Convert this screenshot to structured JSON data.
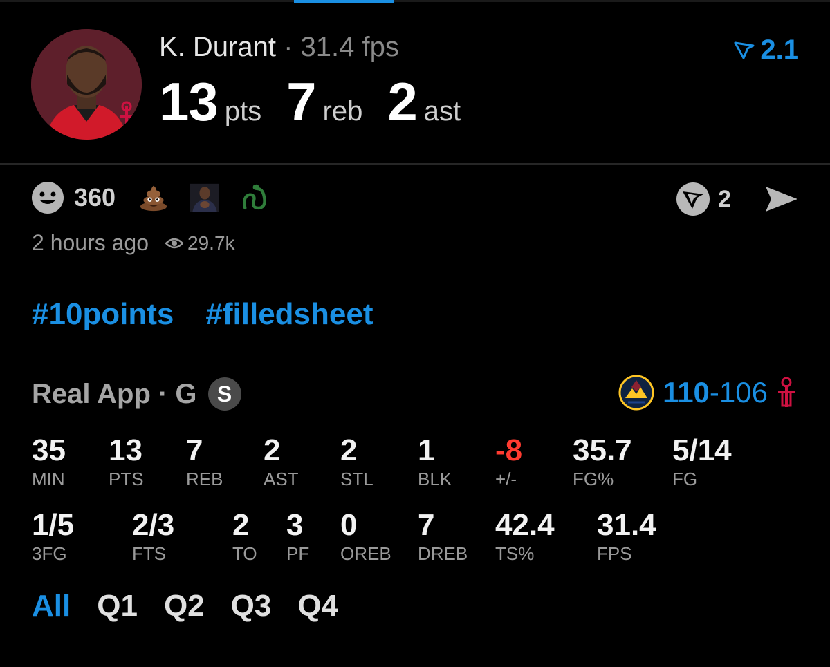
{
  "player": {
    "name": "K. Durant",
    "separator": "·",
    "fps": "31.4 fps",
    "pts": "13",
    "pts_label": "pts",
    "reb": "7",
    "reb_label": "reb",
    "ast": "2",
    "ast_label": "ast",
    "rating": "2.1"
  },
  "reactions": {
    "count": "360",
    "emojis": [
      "poop-emoji",
      "clapping-man-sticker",
      "snake-emoji"
    ]
  },
  "actions": {
    "count": "2"
  },
  "meta": {
    "time": "2 hours ago",
    "views": "29.7k"
  },
  "hashtags": [
    "#10points",
    "#filledsheet"
  ],
  "game": {
    "source": "Real App · G",
    "badge": "S",
    "score_a": "110",
    "score_dash": "-",
    "score_b": "106"
  },
  "stats_row1": [
    {
      "value": "35",
      "label": "MIN"
    },
    {
      "value": "13",
      "label": "PTS"
    },
    {
      "value": "7",
      "label": "REB"
    },
    {
      "value": "2",
      "label": "AST"
    },
    {
      "value": "2",
      "label": "STL"
    },
    {
      "value": "1",
      "label": "BLK"
    },
    {
      "value": "-8",
      "label": "+/-"
    },
    {
      "value": "35.7",
      "label": "FG%"
    },
    {
      "value": "5/14",
      "label": "FG"
    }
  ],
  "stats_row2": [
    {
      "value": "1/5",
      "label": "3FG"
    },
    {
      "value": "2/3",
      "label": "FTS"
    },
    {
      "value": "2",
      "label": "TO"
    },
    {
      "value": "3",
      "label": "PF"
    },
    {
      "value": "0",
      "label": "OREB"
    },
    {
      "value": "7",
      "label": "DREB"
    },
    {
      "value": "42.4",
      "label": "TS%"
    },
    {
      "value": "31.4",
      "label": "FPS"
    }
  ],
  "tabs": [
    "All",
    "Q1",
    "Q2",
    "Q3",
    "Q4"
  ],
  "colors": {
    "accent": "#1a8fe3",
    "negative": "#ff3b30",
    "rockets": "#ce1141"
  }
}
